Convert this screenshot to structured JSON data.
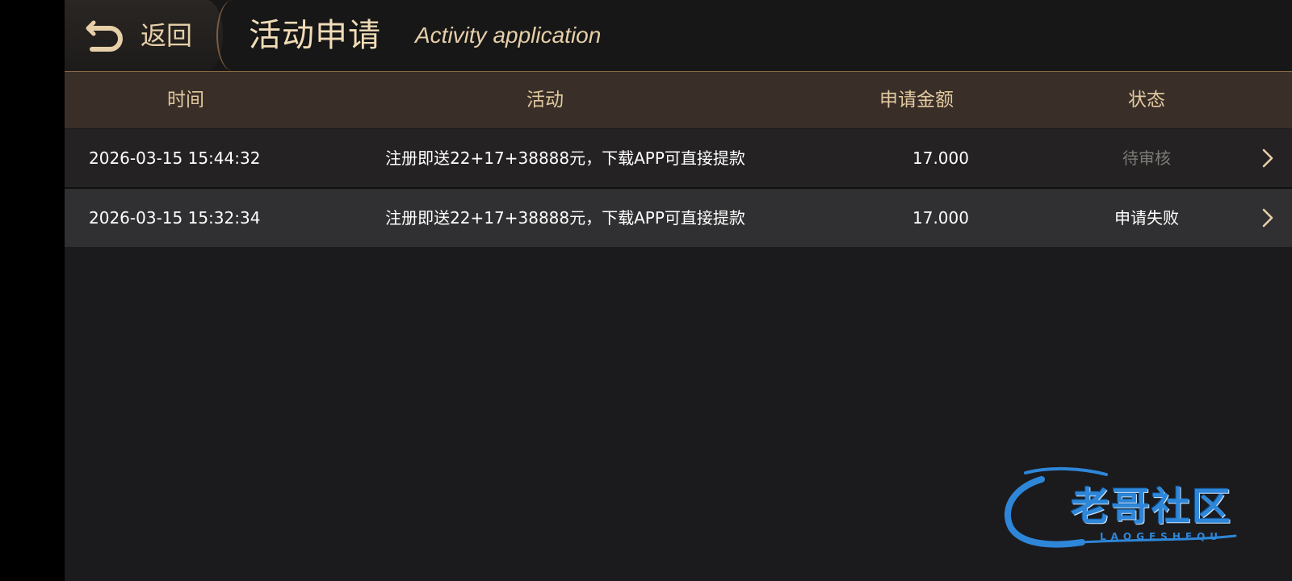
{
  "header": {
    "back_label": "返回",
    "title": "活动申请",
    "subtitle": "Activity application"
  },
  "table": {
    "columns": [
      "时间",
      "活动",
      "申请金额",
      "状态"
    ],
    "rows": [
      {
        "time": "2026-03-15 15:44:32",
        "activity": "注册即送22+17+38888元，下载APP可直接提款",
        "amount": "17.000",
        "status": "待审核"
      },
      {
        "time": "2026-03-15 15:32:34",
        "activity": "注册即送22+17+38888元，下载APP可直接提款",
        "amount": "17.000",
        "status": "申请失败"
      }
    ]
  },
  "watermark": {
    "name": "老哥社区",
    "latin": "LAOGESHEQU"
  },
  "colors": {
    "accent_gold": "#e6cfa9",
    "header_bg": "#171717",
    "table_header_bg": "#3a2f28",
    "pending_status": "#7d7a76",
    "watermark_blue": "#2e86d8"
  },
  "icons": {
    "back": "undo-arrow-icon",
    "row_action": "chevron-right-icon"
  }
}
